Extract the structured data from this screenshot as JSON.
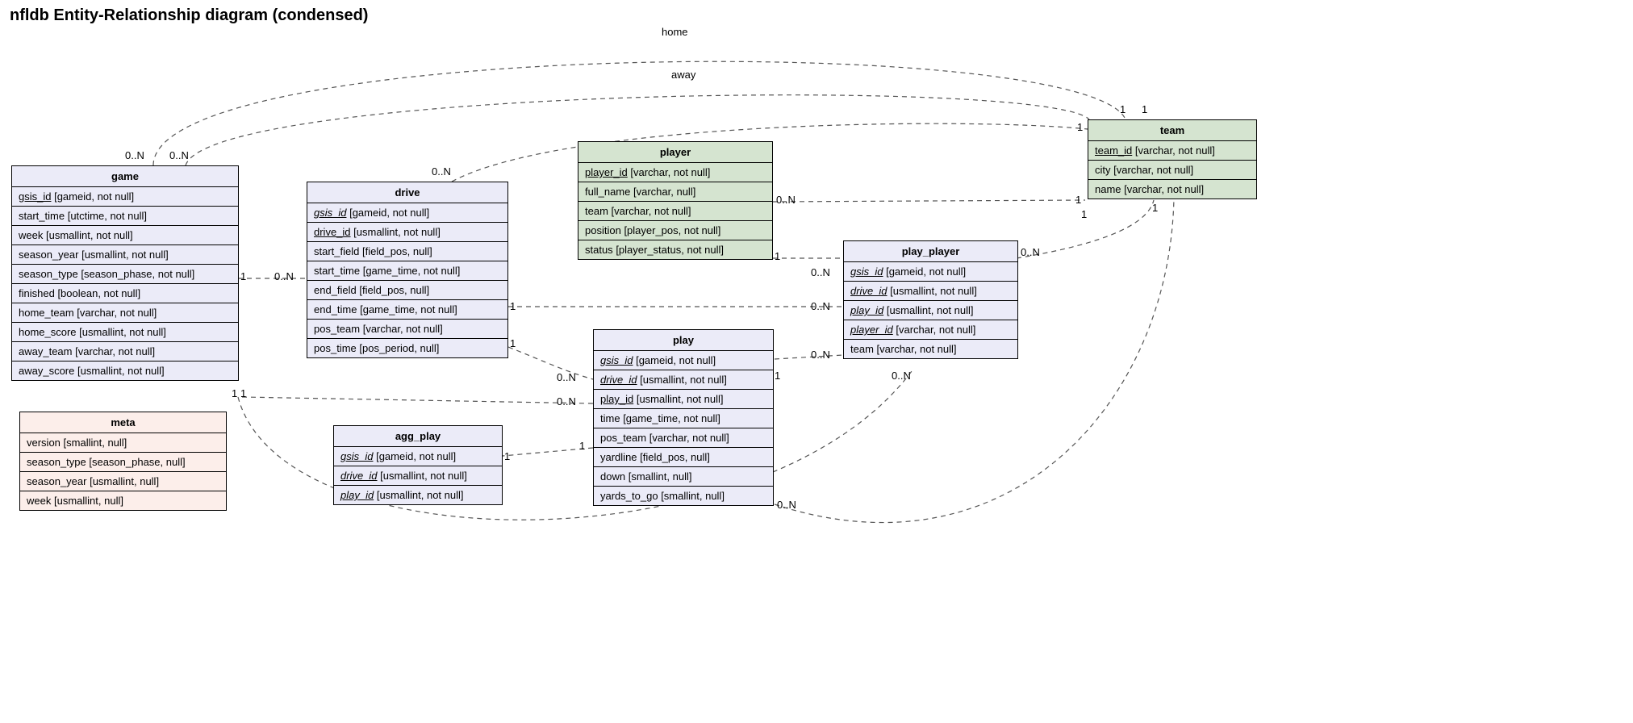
{
  "title": "nfldb Entity-Relationship diagram (condensed)",
  "entities": {
    "game": {
      "name": "game",
      "fields": [
        {
          "n": "gsis_id",
          "t": "[gameid, not null]",
          "k": "pk"
        },
        {
          "n": "start_time",
          "t": "[utctime, not null]"
        },
        {
          "n": "week",
          "t": "[usmallint, not null]"
        },
        {
          "n": "season_year",
          "t": "[usmallint, not null]"
        },
        {
          "n": "season_type",
          "t": "[season_phase, not null]"
        },
        {
          "n": "finished",
          "t": "[boolean, not null]"
        },
        {
          "n": "home_team",
          "t": "[varchar, not null]"
        },
        {
          "n": "home_score",
          "t": "[usmallint, not null]"
        },
        {
          "n": "away_team",
          "t": "[varchar, not null]"
        },
        {
          "n": "away_score",
          "t": "[usmallint, not null]"
        }
      ]
    },
    "drive": {
      "name": "drive",
      "fields": [
        {
          "n": "gsis_id",
          "t": "[gameid, not null]",
          "k": "fk"
        },
        {
          "n": "drive_id",
          "t": "[usmallint, not null]",
          "k": "pk"
        },
        {
          "n": "start_field",
          "t": "[field_pos, null]"
        },
        {
          "n": "start_time",
          "t": "[game_time, not null]"
        },
        {
          "n": "end_field",
          "t": "[field_pos, null]"
        },
        {
          "n": "end_time",
          "t": "[game_time, not null]"
        },
        {
          "n": "pos_team",
          "t": "[varchar, not null]"
        },
        {
          "n": "pos_time",
          "t": "[pos_period, null]"
        }
      ]
    },
    "play": {
      "name": "play",
      "fields": [
        {
          "n": "gsis_id",
          "t": "[gameid, not null]",
          "k": "fk"
        },
        {
          "n": "drive_id",
          "t": "[usmallint, not null]",
          "k": "fk"
        },
        {
          "n": "play_id",
          "t": "[usmallint, not null]",
          "k": "pk"
        },
        {
          "n": "time",
          "t": "[game_time, not null]"
        },
        {
          "n": "pos_team",
          "t": "[varchar, not null]"
        },
        {
          "n": "yardline",
          "t": "[field_pos, null]"
        },
        {
          "n": "down",
          "t": "[smallint, null]"
        },
        {
          "n": "yards_to_go",
          "t": "[smallint, null]"
        }
      ]
    },
    "agg_play": {
      "name": "agg_play",
      "fields": [
        {
          "n": "gsis_id",
          "t": "[gameid, not null]",
          "k": "fk"
        },
        {
          "n": "drive_id",
          "t": "[usmallint, not null]",
          "k": "fk"
        },
        {
          "n": "play_id",
          "t": "[usmallint, not null]",
          "k": "fk"
        }
      ]
    },
    "play_player": {
      "name": "play_player",
      "fields": [
        {
          "n": "gsis_id",
          "t": "[gameid, not null]",
          "k": "fk"
        },
        {
          "n": "drive_id",
          "t": "[usmallint, not null]",
          "k": "fk"
        },
        {
          "n": "play_id",
          "t": "[usmallint, not null]",
          "k": "fk"
        },
        {
          "n": "player_id",
          "t": "[varchar, not null]",
          "k": "fk"
        },
        {
          "n": "team",
          "t": "[varchar, not null]"
        }
      ]
    },
    "player": {
      "name": "player",
      "fields": [
        {
          "n": "player_id",
          "t": "[varchar, not null]",
          "k": "pk"
        },
        {
          "n": "full_name",
          "t": "[varchar, null]"
        },
        {
          "n": "team",
          "t": "[varchar, not null]"
        },
        {
          "n": "position",
          "t": "[player_pos, not null]"
        },
        {
          "n": "status",
          "t": "[player_status, not null]"
        }
      ]
    },
    "team": {
      "name": "team",
      "fields": [
        {
          "n": "team_id",
          "t": "[varchar, not null]",
          "k": "pk"
        },
        {
          "n": "city",
          "t": "[varchar, not null]"
        },
        {
          "n": "name",
          "t": "[varchar, not null]"
        }
      ]
    },
    "meta": {
      "name": "meta",
      "fields": [
        {
          "n": "version",
          "t": "[smallint, null]"
        },
        {
          "n": "season_type",
          "t": "[season_phase, null]"
        },
        {
          "n": "season_year",
          "t": "[usmallint, null]"
        },
        {
          "n": "week",
          "t": "[usmallint, null]"
        }
      ]
    }
  },
  "relationships": [
    {
      "from": "game",
      "to": "team",
      "label": "home",
      "from_card": "0..N",
      "to_card": "1"
    },
    {
      "from": "game",
      "to": "team",
      "label": "away",
      "from_card": "0..N",
      "to_card": "1"
    },
    {
      "from": "game",
      "to": "drive",
      "from_card": "1",
      "to_card": "0..N"
    },
    {
      "from": "game",
      "to": "play",
      "from_card": "1",
      "to_card": "0..N"
    },
    {
      "from": "game",
      "to": "play_player",
      "from_card": "1",
      "to_card": "0..N"
    },
    {
      "from": "drive",
      "to": "play",
      "from_card": "1",
      "to_card": "0..N"
    },
    {
      "from": "drive",
      "to": "play_player",
      "from_card": "1",
      "to_card": "0..N"
    },
    {
      "from": "drive",
      "to": "team",
      "from_card": "0..N",
      "to_card": "1"
    },
    {
      "from": "play",
      "to": "agg_play",
      "from_card": "1",
      "to_card": "1"
    },
    {
      "from": "play",
      "to": "play_player",
      "from_card": "1",
      "to_card": "0..N"
    },
    {
      "from": "play",
      "to": "team",
      "from_card": "0..N",
      "to_card": "1"
    },
    {
      "from": "player",
      "to": "play_player",
      "from_card": "1",
      "to_card": "0..N"
    },
    {
      "from": "player",
      "to": "team",
      "from_card": "0..N",
      "to_card": "1"
    },
    {
      "from": "play_player",
      "to": "team",
      "from_card": "0..N",
      "to_card": "1"
    }
  ],
  "cards": {
    "game_home_n": "0..N",
    "game_away_n": "0..N",
    "team_home_1": "1",
    "team_away_1": "1",
    "game_drive_1": "1",
    "game_drive_n": "0..N",
    "game_play_1": "1",
    "game_play_n": "0..N",
    "game_pp_1": "1",
    "game_pp_n": "0..N",
    "drive_play_1": "1",
    "drive_play_n": "0..N",
    "drive_pp_1": "1",
    "drive_pp_n": "0..N",
    "drive_team_n": "0..N",
    "drive_team_1": "1",
    "play_agg_a": "1",
    "play_agg_b": "1",
    "play_pp_1": "1",
    "play_pp_n": "0..N",
    "play_team_n": "0..N",
    "play_team_1": "1",
    "player_pp_1": "1",
    "player_pp_n": "0..N",
    "player_team_n": "0..N",
    "player_team_1": "1",
    "pp_team_n": "0..N",
    "pp_team_1": "1",
    "rel_home": "home",
    "rel_away": "away"
  }
}
